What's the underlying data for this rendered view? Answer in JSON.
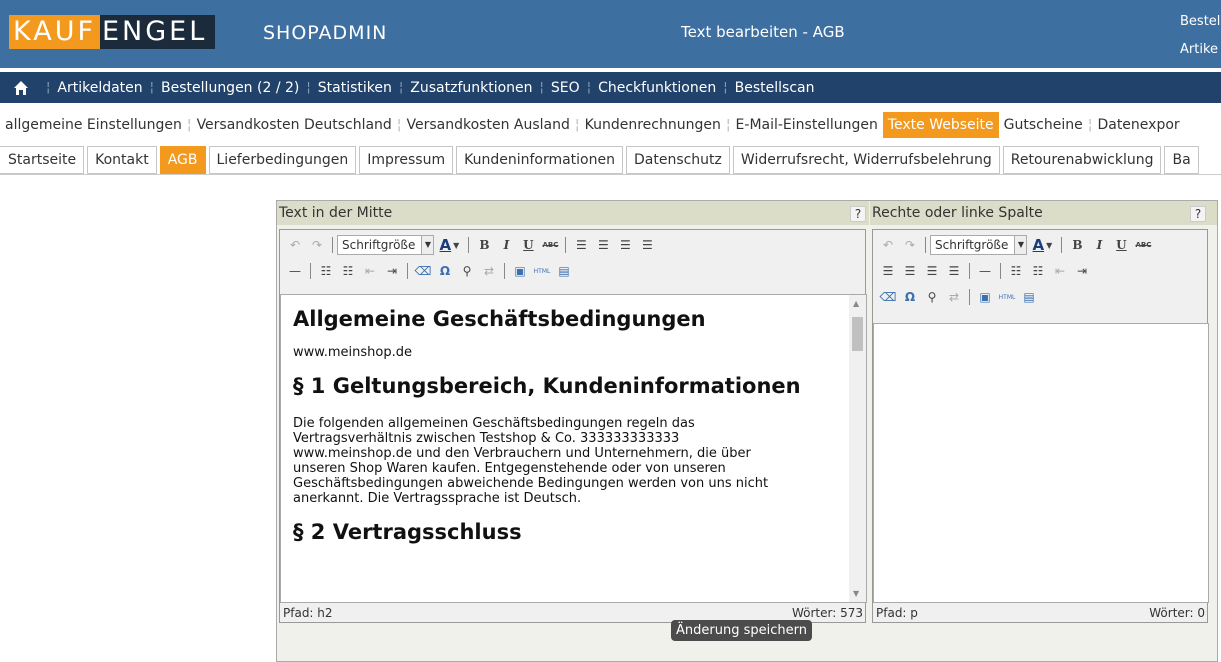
{
  "header": {
    "logo_part1": "KAUF",
    "logo_part2": "ENGEL",
    "app_name": "SHOPADMIN",
    "page_title": "Text bearbeiten - AGB",
    "right_line1": "Bestel",
    "right_line2": "Artike"
  },
  "main_nav": {
    "items": [
      "Artikeldaten",
      "Bestellungen (2 / 2)",
      "Statistiken",
      "Zusatzfunktionen",
      "SEO",
      "Checkfunktionen",
      "Bestellscan"
    ]
  },
  "sub_nav": {
    "items": [
      "allgemeine Einstellungen",
      "Versandkosten Deutschland",
      "Versandkosten Ausland",
      "Kundenrechnungen",
      "E-Mail-Einstellungen",
      "Texte Webseite",
      "Gutscheine",
      "Datenexpor"
    ],
    "active": "Texte Webseite"
  },
  "tabs": {
    "items": [
      "Startseite",
      "Kontakt",
      "AGB",
      "Lieferbedingungen",
      "Impressum",
      "Kundeninformationen",
      "Datenschutz",
      "Widerrufsrecht, Widerrufsbelehrung",
      "Retourenabwicklung",
      "Ba"
    ],
    "active": "AGB"
  },
  "left_editor": {
    "title": "Text in der Mitte",
    "help": "?",
    "font_size_select": "Schriftgröße",
    "content": {
      "h1": "Allgemeine Geschäftsbedingungen",
      "url": "www.meinshop.de",
      "h2_1": "§ 1 Geltungsbereich, Kundeninformationen",
      "para_lines": [
        "Die folgenden allgemeinen Geschäftsbedingungen regeln das",
        "Vertragsverhältnis zwischen Testshop & Co. 333333333333",
        "www.meinshop.de und den Verbrauchern und Unternehmern, die über",
        "unseren Shop Waren kaufen. Entgegenstehende oder von unseren",
        "Geschäftsbedingungen abweichende Bedingungen werden von uns nicht",
        "anerkannt. Die Vertragssprache ist Deutsch."
      ],
      "h2_2": "§ 2 Vertragsschluss"
    },
    "path": "Pfad: h2",
    "words": "Wörter: 573"
  },
  "right_editor": {
    "title": "Rechte oder linke Spalte",
    "help": "?",
    "font_size_select": "Schriftgröße",
    "path": "Pfad: p",
    "words": "Wörter: 0"
  },
  "save_button": "Änderung speichern",
  "colors": {
    "header_bg": "#3d6fa1",
    "nav_bg": "#21426a",
    "accent": "#f39a1e"
  }
}
